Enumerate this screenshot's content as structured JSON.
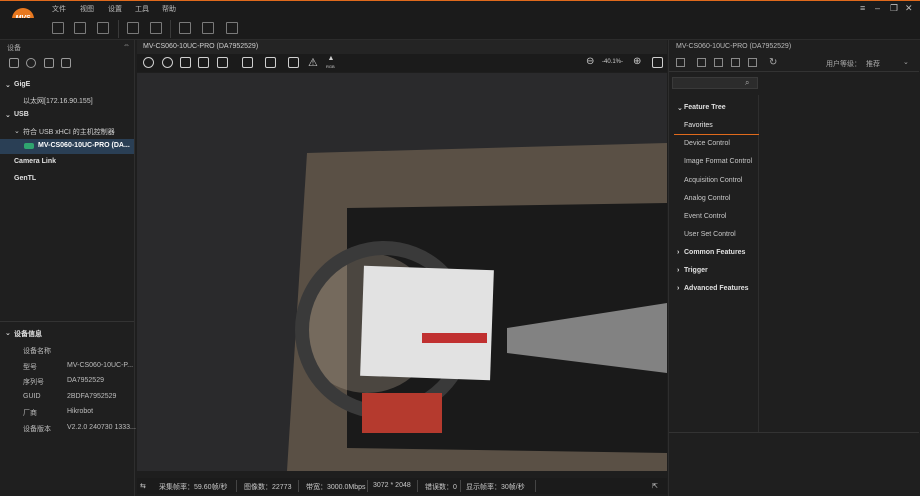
{
  "app": {
    "logo_text": "MVS",
    "accent": "#e06a1c"
  },
  "menu": [
    "文件",
    "视图",
    "设置",
    "工具",
    "帮助"
  ],
  "left_panel": {
    "title": "设备",
    "tree": {
      "gige": "GigE",
      "gige_child": "以太网[172.16.90.155]",
      "usb": "USB",
      "usb_controller": "符合 USB xHCI 的主机控制器",
      "usb_device": "MV-CS060-10UC-PRO (DA...",
      "camera_link": "Camera Link",
      "gentl": "GenTL"
    },
    "info": {
      "title": "设备信息",
      "rows": [
        {
          "label": "设备名称",
          "value": ""
        },
        {
          "label": "型号",
          "value": "MV-CS060-10UC-P..."
        },
        {
          "label": "序列号",
          "value": "DA7952529"
        },
        {
          "label": "GUID",
          "value": "2BDFA7952529"
        },
        {
          "label": "厂商",
          "value": "Hikrobot"
        },
        {
          "label": "设备版本",
          "value": "V2.2.0 240730 1333..."
        }
      ]
    }
  },
  "viewer": {
    "title": "MV-CS060-10UC-PRO (DA7952529)",
    "zoom": "-40.1%-",
    "rgb_label": "RGB"
  },
  "status": {
    "capture_rate": "采集帧率：59.60帧/秒",
    "frame_count": "图像数：22773",
    "bandwidth": "带宽：3000.0Mbps",
    "resolution": "3072 * 2048",
    "errors": "错误数：0",
    "display_rate": "显示帧率：30帧/秒"
  },
  "right_panel": {
    "title": "MV-CS060-10UC-PRO (DA7952529)",
    "user_level_label": "用户等级：",
    "user_level_value": "推荐",
    "feature_tree": "Feature Tree",
    "items": [
      "Favorites",
      "Device Control",
      "Image Format Control",
      "Acquisition Control",
      "Analog Control",
      "Event Control",
      "User Set Control"
    ],
    "groups": [
      "Common Features",
      "Trigger",
      "Advanced Features"
    ]
  }
}
